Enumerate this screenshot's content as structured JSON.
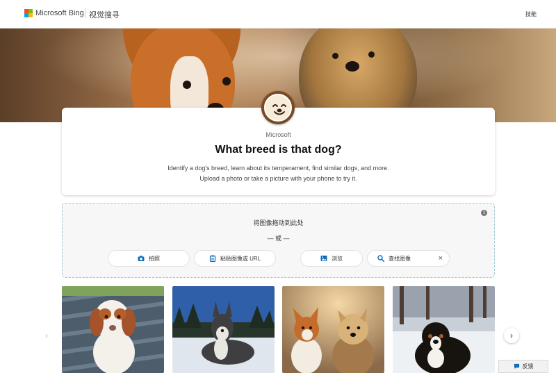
{
  "header": {
    "brand": "Microsoft Bing",
    "subtitle": "视觉搜寻",
    "skills_link": "技能",
    "logo_colors": [
      "#f25022",
      "#7fba00",
      "#00a4ef",
      "#ffb900"
    ]
  },
  "card": {
    "company": "Microsoft",
    "title": "What breed is that dog?",
    "description": "Identify a dog's breed, learn about its temperament, find similar dogs, and more. Upload a photo or take a picture with your phone to try it."
  },
  "dropzone": {
    "prompt": "将图像拖动到此处",
    "or_text": "— 或 —",
    "buttons": [
      {
        "label": "拍照",
        "icon": "camera-icon"
      },
      {
        "label": "粘贴图像或 URL",
        "icon": "paste-icon"
      },
      {
        "label": "浏览",
        "icon": "image-icon"
      }
    ],
    "search_label": "查找图像",
    "accent": "#0f6cbd"
  },
  "gallery": {
    "items": [
      {
        "name": "brittany-spaniel-puppy-photo"
      },
      {
        "name": "husky-in-snow-photo"
      },
      {
        "name": "corgi-and-yorkie-photo"
      },
      {
        "name": "bernese-mountain-dog-photo"
      }
    ]
  },
  "feedback_label": "反馈"
}
